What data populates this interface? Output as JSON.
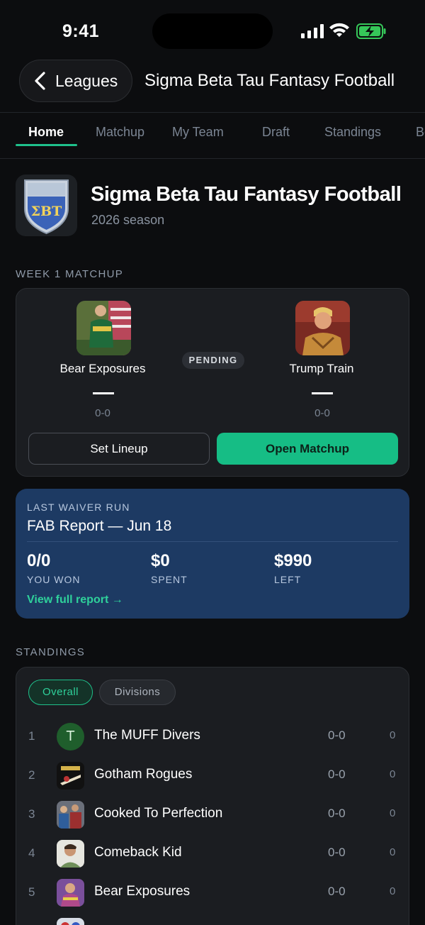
{
  "status_bar": {
    "time": "9:41"
  },
  "header": {
    "back_label": "Leagues",
    "title": "Sigma Beta Tau Fantasy Football"
  },
  "tabs": [
    {
      "label": "Home",
      "active": true
    },
    {
      "label": "Matchup"
    },
    {
      "label": "My Team"
    },
    {
      "label": "Draft"
    },
    {
      "label": "Standings"
    },
    {
      "label": "Bo"
    }
  ],
  "league": {
    "name": "Sigma Beta Tau Fantasy Football",
    "season": "2026 season",
    "logo_letters": "ΣBT"
  },
  "matchup": {
    "section_label": "WEEK 1 MATCHUP",
    "status": "PENDING",
    "home": {
      "name": "Bear Exposures",
      "score": "—",
      "record": "0-0"
    },
    "away": {
      "name": "Trump Train",
      "score": "—",
      "record": "0-0"
    },
    "set_lineup_label": "Set Lineup",
    "open_matchup_label": "Open Matchup"
  },
  "waiver": {
    "kicker": "LAST WAIVER RUN",
    "title": "FAB Report — Jun 18",
    "stats": [
      {
        "value": "0/0",
        "label": "YOU WON"
      },
      {
        "value": "$0",
        "label": "SPENT"
      },
      {
        "value": "$990",
        "label": "LEFT"
      }
    ],
    "link_label": "View full report →"
  },
  "standings": {
    "section_label": "STANDINGS",
    "filters": [
      "Overall",
      "Divisions"
    ],
    "rows": [
      {
        "rank": "1",
        "name": "The MUFF Divers",
        "record": "0-0",
        "points": "0",
        "avatar_letter": "T"
      },
      {
        "rank": "2",
        "name": "Gotham Rogues",
        "record": "0-0",
        "points": "0"
      },
      {
        "rank": "3",
        "name": "Cooked To Perfection",
        "record": "0-0",
        "points": "0"
      },
      {
        "rank": "4",
        "name": "Comeback Kid",
        "record": "0-0",
        "points": "0"
      },
      {
        "rank": "5",
        "name": "Bear Exposures",
        "record": "0-0",
        "points": "0"
      }
    ]
  },
  "colors": {
    "accent": "#16bd85",
    "background": "#0c0d0f",
    "card": "#1b1d21",
    "waiver_card": "#1d3a63"
  }
}
